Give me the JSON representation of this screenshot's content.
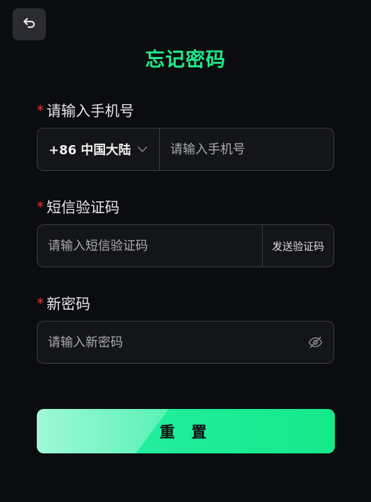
{
  "page": {
    "title": "忘记密码"
  },
  "back_button": {
    "icon": "undo-arrow-icon"
  },
  "form": {
    "phone": {
      "required_mark": "*",
      "label": "请输入手机号",
      "country_code": "+86 中国大陆",
      "placeholder": "请输入手机号",
      "value": ""
    },
    "sms": {
      "required_mark": "*",
      "label": "短信验证码",
      "placeholder": "请输入短信验证码",
      "value": "",
      "send_label": "发送验证码"
    },
    "password": {
      "required_mark": "*",
      "label": "新密码",
      "placeholder": "请输入新密码",
      "value": "",
      "visibility_icon": "eye-off-icon"
    }
  },
  "submit": {
    "label": "重 置"
  },
  "colors": {
    "accent": "#22e889",
    "background": "#0b0c10",
    "required": "#ee3333"
  }
}
